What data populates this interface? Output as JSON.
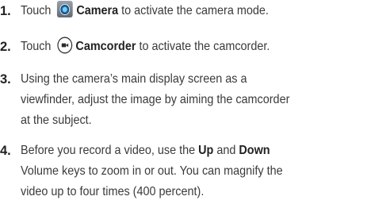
{
  "steps": [
    {
      "number": "1.",
      "pre": "Touch ",
      "bold": "Camera",
      "post": " to activate the camera mode."
    },
    {
      "number": "2.",
      "pre": "Touch ",
      "bold": "Camcorder",
      "post": " to activate the camcorder."
    },
    {
      "number": "3.",
      "line1": "Using the camera’s main display screen as a",
      "line2": "viewfinder, adjust the image by aiming the camcorder",
      "line3": "at the subject."
    },
    {
      "number": "4.",
      "line1_pre": "Before you record a video, use the ",
      "line1_bold1": "Up",
      "line1_mid": " and ",
      "line1_bold2": "Down",
      "line2": "Volume keys to zoom in or out. You can magnify the",
      "line3": "video up to four times (400 percent)."
    }
  ],
  "icons": {
    "camera": "camera-app-icon",
    "camcorder": "camcorder-mode-icon"
  }
}
